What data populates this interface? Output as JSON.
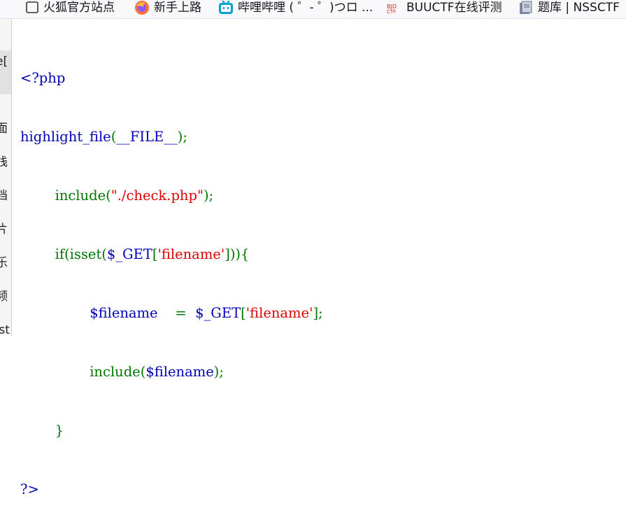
{
  "bookmarks": [
    {
      "label": "火狐官方站点",
      "icon": "page-icon"
    },
    {
      "label": "新手上路",
      "icon": "firefox-icon"
    },
    {
      "label": "哔哩哔哩 ( ゜- ゜)つロ ...",
      "icon": "bilibili-icon"
    },
    {
      "label": "BUUCTF在线评测",
      "icon": "buuctf-icon"
    },
    {
      "label": "题库 | NSSCTF",
      "icon": "nssctf-icon"
    }
  ],
  "sidebar": {
    "items": [
      "e[",
      "面",
      "栈",
      "档",
      "片",
      "乐",
      "频",
      "ost"
    ]
  },
  "code": {
    "open_tag": "<?php",
    "hl_fn": "highlight_file",
    "hl_open": "(",
    "hl_const": "__FILE__",
    "hl_close": ");",
    "indent1": "        ",
    "inc1_kw": "include(",
    "inc1_str": "\"./check.php\"",
    "inc1_end": ");",
    "if_kw": "if(isset(",
    "get_var": "$_GET",
    "br_open": "[",
    "key_str": "'filename'",
    "if_close": "])){",
    "indent2": "                ",
    "fn_var": "$filename",
    "eq": "    =  ",
    "get_var2": "$_GET",
    "br_open2": "[",
    "key_str2": "'filename'",
    "br_close2": "];",
    "inc2_kw": "include(",
    "inc2_var": "$filename",
    "inc2_end": ");",
    "brace": "}",
    "close_tag": "?>"
  },
  "colors": {
    "keyword": "#0000bb",
    "default": "#007700",
    "string": "#dd0000"
  }
}
